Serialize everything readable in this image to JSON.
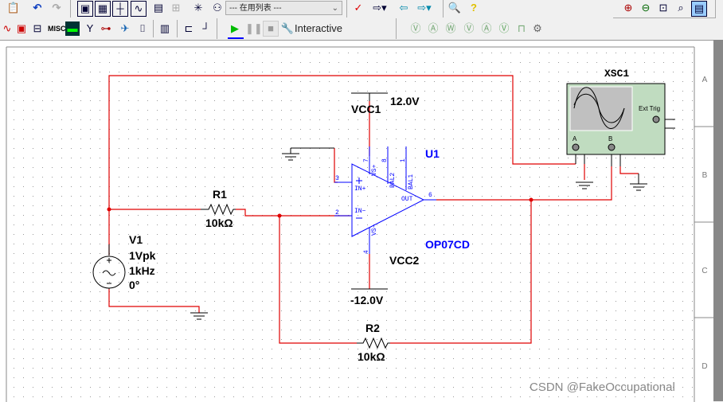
{
  "toolbar": {
    "list_dropdown": "--- 在用列表 ---",
    "interactive_label": "Interactive",
    "misc_label": "MISC",
    "icons_row1": [
      "paste-icon",
      "undo-icon",
      "redo-icon",
      "design-toolbox-icon",
      "spreadsheet-icon",
      "grapher-icon",
      "postprocessor-icon",
      "database-icon",
      "component-wizard-icon",
      "place-component-icon",
      "netlist-icon",
      "erc-icon",
      "back-annotate-icon",
      "forward-annotate-icon",
      "find-icon",
      "help-icon"
    ],
    "icons_row2": [
      "play-icon",
      "pause-icon",
      "stop-icon",
      "wrench-icon"
    ],
    "zoom_icons": [
      "zoom-in-icon",
      "zoom-out-icon",
      "zoom-area-icon",
      "zoom-fit-icon",
      "full-screen-icon"
    ],
    "probe_icons": [
      "voltage-probe-icon",
      "current-probe-icon",
      "power-probe-icon",
      "diff-voltage-probe-icon",
      "voltage-current-probe-icon",
      "reference-probe-icon",
      "digital-probe-icon",
      "probe-settings-icon"
    ]
  },
  "schematic": {
    "border_rows": [
      "A",
      "B",
      "C",
      "D"
    ],
    "colors": {
      "wire": "#e00000",
      "component": "#0000ff",
      "text": "#000000",
      "scope_body": "#c0dcc0"
    },
    "vcc1": {
      "name": "VCC1",
      "value": "12.0V"
    },
    "vcc2": {
      "name": "VCC2",
      "value": "-12.0V"
    },
    "opamp": {
      "ref": "U1",
      "model": "OP07CD",
      "pins": {
        "in_plus": "3",
        "in_minus": "2",
        "vs_plus": "7",
        "vs_minus": "4",
        "bal2": "8",
        "bal1": "1",
        "out": "6"
      },
      "pin_names": {
        "in_plus": "IN+",
        "in_minus": "IN−",
        "vs_plus": "VS+",
        "vs_minus": "VS−",
        "bal2": "BAL2",
        "bal1": "BAL1",
        "out": "OUT"
      }
    },
    "r1": {
      "ref": "R1",
      "value": "10kΩ"
    },
    "r2": {
      "ref": "R2",
      "value": "10kΩ"
    },
    "v1": {
      "ref": "V1",
      "amplitude": "1Vpk",
      "frequency": "1kHz",
      "phase": "0°"
    },
    "scope": {
      "ref": "XSC1",
      "ext_trig": "Ext Trig",
      "ch_a": "A",
      "ch_b": "B"
    }
  },
  "watermark": "CSDN @FakeOccupational"
}
